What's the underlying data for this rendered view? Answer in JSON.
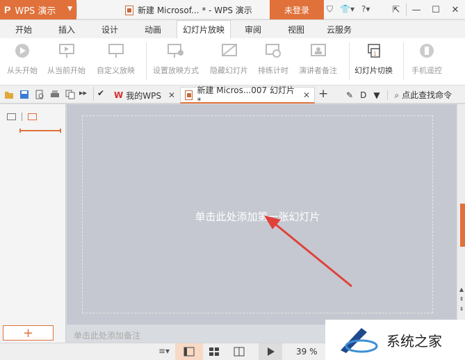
{
  "title_bar": {
    "app_name": "WPS 演示",
    "doc_title": "新建 Microsof... * - WPS 演示",
    "login_label": "未登录"
  },
  "menu_tabs": [
    "开始",
    "插入",
    "设计",
    "动画",
    "幻灯片放映",
    "审阅",
    "视图",
    "云服务"
  ],
  "active_menu_tab": "幻灯片放映",
  "ribbon": {
    "from_start": "从头开始",
    "from_current": "从当前开始",
    "custom_show": "自定义放映",
    "setup_show": "设置放映方式",
    "hide_slide": "隐藏幻灯片",
    "rehearse": "排练计时",
    "presenter_notes": "演讲者备注",
    "slide_transition": "幻灯片切换",
    "phone_remote": "手机遥控"
  },
  "tabs": {
    "mywps": "我的WPS",
    "current_doc": "新建 Micros...007 幻灯片 *",
    "search_cmd": "点此查找命令"
  },
  "slide": {
    "placeholder": "单击此处添加第一张幻灯片"
  },
  "notes_placeholder": "单击此处添加备注",
  "status": {
    "zoom": "39 %"
  },
  "watermark": "系统之家",
  "colors": {
    "accent": "#e0713b",
    "arrow": "#e0413b"
  }
}
